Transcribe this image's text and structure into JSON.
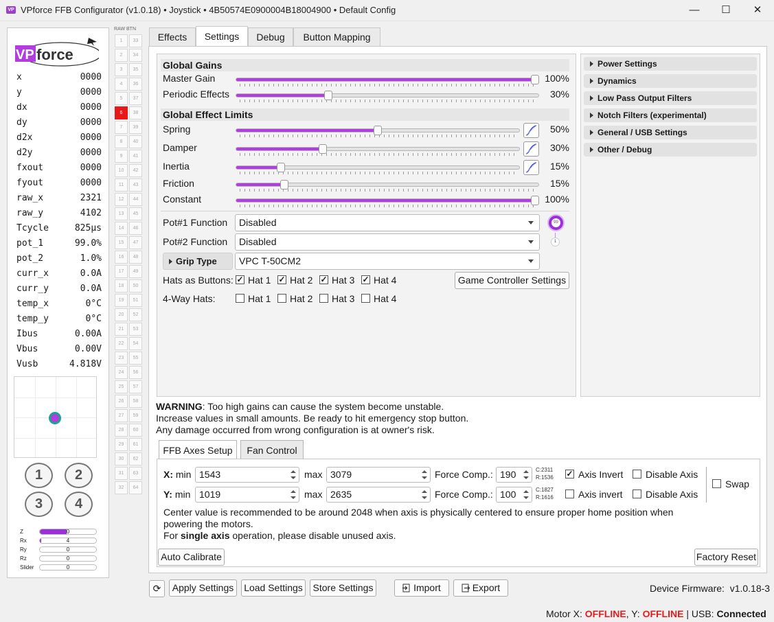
{
  "window": {
    "title": "VPforce FFB Configurator (v1.0.18) • Joystick • 4B50574E0900004B18004900 • Default Config",
    "app_icon": "VP",
    "minimize": "—",
    "maximize": "☐",
    "close": "✕"
  },
  "logo": {
    "text": "VPforce"
  },
  "stats": [
    {
      "k": "x",
      "v": "0000"
    },
    {
      "k": "y",
      "v": "0000"
    },
    {
      "k": "dx",
      "v": "0000"
    },
    {
      "k": "dy",
      "v": "0000"
    },
    {
      "k": "d2x",
      "v": "0000"
    },
    {
      "k": "d2y",
      "v": "0000"
    },
    {
      "k": "fxout",
      "v": "0000"
    },
    {
      "k": "fyout",
      "v": "0000"
    },
    {
      "k": "raw_x",
      "v": "2321"
    },
    {
      "k": "raw_y",
      "v": "4102"
    },
    {
      "k": "Tcycle",
      "v": "825µs"
    },
    {
      "k": "pot_1",
      "v": "99.0%"
    },
    {
      "k": "pot_2",
      "v": "1.0%"
    },
    {
      "k": "curr_x",
      "v": "0.0A"
    },
    {
      "k": "curr_y",
      "v": "0.0A"
    },
    {
      "k": "temp_x",
      "v": "0°C"
    },
    {
      "k": "temp_y",
      "v": "0°C"
    },
    {
      "k": "Ibus",
      "v": "0.00A"
    },
    {
      "k": "Vbus",
      "v": "0.00V"
    },
    {
      "k": "Vusb",
      "v": "4.818V"
    }
  ],
  "hat_buttons": [
    "1",
    "2",
    "3",
    "4"
  ],
  "axes_bars": [
    {
      "name": "Z",
      "value": "0",
      "fraction": 0.48
    },
    {
      "name": "Rx",
      "value": "4",
      "fraction": 0.02
    },
    {
      "name": "Ry",
      "value": "0",
      "fraction": 0
    },
    {
      "name": "Rz",
      "value": "0",
      "fraction": 0
    },
    {
      "name": "Slider",
      "value": "0",
      "fraction": 0
    }
  ],
  "button_grid": {
    "header": "RAW BTN",
    "left": [
      "1",
      "2",
      "3",
      "4",
      "5",
      "6",
      "7",
      "8",
      "9",
      "10",
      "11",
      "12",
      "13",
      "14",
      "15",
      "16",
      "17",
      "18",
      "19",
      "20",
      "21",
      "22",
      "23",
      "24",
      "25",
      "26",
      "27",
      "28",
      "29",
      "30",
      "31",
      "32"
    ],
    "right": [
      "33",
      "34",
      "35",
      "36",
      "37",
      "38",
      "39",
      "40",
      "41",
      "42",
      "43",
      "44",
      "45",
      "46",
      "47",
      "48",
      "49",
      "50",
      "51",
      "52",
      "53",
      "54",
      "55",
      "56",
      "57",
      "58",
      "59",
      "60",
      "61",
      "62",
      "63",
      "64"
    ],
    "pressed": "6"
  },
  "tabs": [
    "Effects",
    "Settings",
    "Debug",
    "Button Mapping"
  ],
  "active_tab": "Settings",
  "settings": {
    "global_gains_title": "Global Gains",
    "gains": [
      {
        "label": "Master Gain",
        "pct": "100%",
        "value": 1.0
      },
      {
        "label": "Periodic Effects",
        "pct": "30%",
        "value": 0.3
      }
    ],
    "limits_title": "Global Effect Limits",
    "limits": [
      {
        "label": "Spring",
        "pct": "50%",
        "value": 0.5,
        "curve": true
      },
      {
        "label": "Damper",
        "pct": "30%",
        "value": 0.3,
        "curve": true
      },
      {
        "label": "Inertia",
        "pct": "15%",
        "value": 0.15,
        "curve": true
      },
      {
        "label": "Friction",
        "pct": "15%",
        "value": 0.15,
        "curve": false
      },
      {
        "label": "Constant",
        "pct": "100%",
        "value": 1.0,
        "curve": false
      }
    ],
    "pot1_label": "Pot#1 Function",
    "pot1_value": "Disabled",
    "pot2_label": "Pot#2 Function",
    "pot2_value": "Disabled",
    "pot_knob_value": "99",
    "pot_small_value": "1",
    "grip_label": "Grip Type",
    "grip_value": "VPC T-50CM2",
    "hats_as_buttons_label": "Hats as Buttons:",
    "four_way_label": "4-Way Hats:",
    "hat_names": [
      "Hat 1",
      "Hat 2",
      "Hat 3",
      "Hat 4"
    ],
    "hats_as_buttons_checked": [
      true,
      true,
      true,
      true
    ],
    "four_way_checked": [
      false,
      false,
      false,
      false
    ],
    "game_controller_button": "Game Controller Settings"
  },
  "right_panel": [
    "Power Settings",
    "Dynamics",
    "Low Pass Output Filters",
    "Notch Filters (experimental)",
    "General / USB Settings",
    "Other / Debug"
  ],
  "warning": {
    "bold": "WARNING",
    "line1": ": Too high gains can cause the system become unstable.",
    "line2": "Increase values in small amounts. Be ready to hit emergency stop button.",
    "line3": "Any damage occurred from wrong configuration is at owner's risk."
  },
  "subtabs": [
    "FFB Axes Setup",
    "Fan Control"
  ],
  "ffb": {
    "x_label": "X:",
    "y_label": "Y:",
    "min_label": "min",
    "max_label": "max",
    "x_min": "1543",
    "x_max": "3079",
    "y_min": "1019",
    "y_max": "2635",
    "force_comp_label": "Force Comp.:",
    "x_force": "190",
    "y_force": "100",
    "x_c": "C:2311",
    "x_r": "R:1536",
    "y_c": "C:1827",
    "y_r": "R:1616",
    "x_invert_label": "Axis Invert",
    "y_invert_label": "Axis invert",
    "x_invert_checked": true,
    "y_invert_checked": false,
    "disable_axis_label": "Disable Axis",
    "swap_label": "Swap",
    "note1": "Center value is recommended to be around 2048 when axis is physically centered to ensure proper home position when",
    "note2": "powering the motors.",
    "note3_pre": "For ",
    "note3_bold": "single axis",
    "note3_post": " operation, please disable unused axis.",
    "auto_calibrate": "Auto Calibrate",
    "factory_reset": "Factory Reset"
  },
  "bottom": {
    "refresh_icon": "⟳",
    "apply": "Apply Settings",
    "load": "Load Settings",
    "store": "Store Settings",
    "import": "Import",
    "export": "Export",
    "firmware_label": "Device Firmware:",
    "firmware_value": "v1.0.18-3"
  },
  "status": {
    "motor_label": "Motor X: ",
    "x_state": "OFFLINE",
    "y_label": ", Y: ",
    "y_state": "OFFLINE",
    "usb_label": " | USB: ",
    "usb_state": "Connected"
  },
  "colors": {
    "accent": "#b23ce0",
    "pressed": "#e81818",
    "status_red": "#e41c1c"
  }
}
